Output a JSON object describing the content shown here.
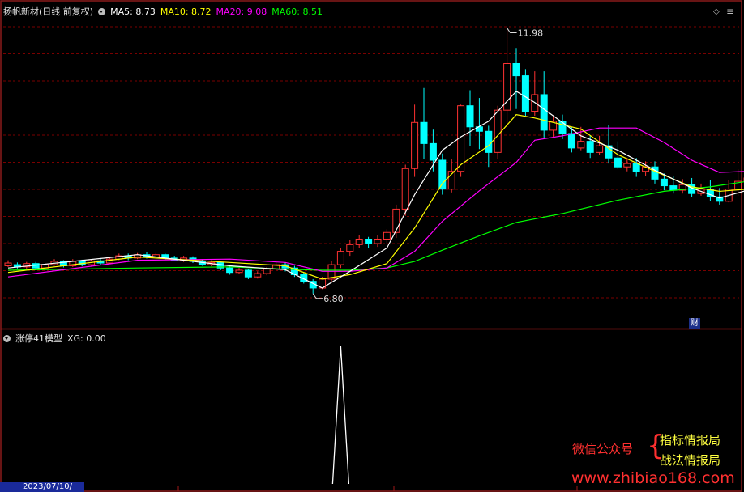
{
  "header": {
    "title": "扬帆新材(日线 前复权)",
    "ma": [
      {
        "label": "MA5:",
        "value": "8.73",
        "color": "#ffffff"
      },
      {
        "label": "MA10:",
        "value": "8.72",
        "color": "#ffff00"
      },
      {
        "label": "MA20:",
        "value": "9.08",
        "color": "#ff00ff"
      },
      {
        "label": "MA60:",
        "value": "8.51",
        "color": "#00ff00"
      }
    ]
  },
  "indicator": {
    "title": "涨停41模型",
    "label": "XG:",
    "value": "0.00"
  },
  "annotations": {
    "high": "11.98",
    "low": "6.80",
    "fin_badge": "财"
  },
  "axis": {
    "date_label": "2023/07/10/"
  },
  "watermark": {
    "left": "微信公众号",
    "right_top": "指标情报局",
    "right_bottom": "战法情报局",
    "url": "www.zhibiao168.com"
  },
  "colors": {
    "up": "#ff3232",
    "down": "#00ffff",
    "ma5": "#ffffff",
    "ma10": "#ffff00",
    "ma20": "#ff00ff",
    "ma60": "#00ff00",
    "grid": "#7a0000"
  },
  "chart_data": {
    "type": "candlestick",
    "yrange": [
      6.6,
      12.25
    ],
    "candles": [
      [
        7.7,
        7.75,
        7.68,
        7.8
      ],
      [
        7.72,
        7.68,
        7.65,
        7.76
      ],
      [
        7.68,
        7.74,
        7.65,
        7.77
      ],
      [
        7.74,
        7.66,
        7.62,
        7.77
      ],
      [
        7.66,
        7.72,
        7.63,
        7.75
      ],
      [
        7.72,
        7.78,
        7.7,
        7.82
      ],
      [
        7.78,
        7.7,
        7.67,
        7.8
      ],
      [
        7.7,
        7.78,
        7.68,
        7.82
      ],
      [
        7.78,
        7.72,
        7.69,
        7.81
      ],
      [
        7.72,
        7.79,
        7.7,
        7.82
      ],
      [
        7.79,
        7.75,
        7.72,
        7.83
      ],
      [
        7.75,
        7.82,
        7.73,
        7.85
      ],
      [
        7.82,
        7.88,
        7.8,
        7.92
      ],
      [
        7.88,
        7.84,
        7.8,
        7.92
      ],
      [
        7.84,
        7.9,
        7.82,
        7.93
      ],
      [
        7.9,
        7.86,
        7.83,
        7.94
      ],
      [
        7.86,
        7.9,
        7.83,
        7.93
      ],
      [
        7.9,
        7.84,
        7.81,
        7.92
      ],
      [
        7.84,
        7.8,
        7.78,
        7.88
      ],
      [
        7.8,
        7.84,
        7.77,
        7.88
      ],
      [
        7.84,
        7.78,
        7.75,
        7.87
      ],
      [
        7.78,
        7.72,
        7.7,
        7.82
      ],
      [
        7.72,
        7.76,
        7.69,
        7.8
      ],
      [
        7.76,
        7.66,
        7.62,
        7.78
      ],
      [
        7.66,
        7.58,
        7.54,
        7.7
      ],
      [
        7.58,
        7.62,
        7.55,
        7.66
      ],
      [
        7.62,
        7.5,
        7.46,
        7.64
      ],
      [
        7.5,
        7.56,
        7.47,
        7.6
      ],
      [
        7.56,
        7.64,
        7.53,
        7.68
      ],
      [
        7.64,
        7.72,
        7.62,
        7.76
      ],
      [
        7.72,
        7.66,
        7.6,
        7.76
      ],
      [
        7.66,
        7.54,
        7.5,
        7.7
      ],
      [
        7.54,
        7.42,
        7.38,
        7.58
      ],
      [
        7.42,
        7.3,
        7.2,
        7.46
      ],
      [
        7.3,
        7.46,
        7.28,
        7.5
      ],
      [
        7.46,
        7.72,
        7.42,
        7.78
      ],
      [
        7.72,
        7.96,
        7.66,
        8.02
      ],
      [
        7.96,
        8.08,
        7.88,
        8.16
      ],
      [
        8.08,
        8.18,
        8.02,
        8.26
      ],
      [
        8.18,
        8.1,
        8.02,
        8.22
      ],
      [
        8.1,
        8.18,
        8.04,
        8.26
      ],
      [
        8.18,
        8.3,
        8.1,
        8.36
      ],
      [
        8.3,
        8.72,
        8.2,
        8.8
      ],
      [
        8.72,
        9.45,
        8.6,
        9.52
      ],
      [
        9.45,
        10.28,
        9.3,
        10.6
      ],
      [
        10.28,
        9.9,
        9.62,
        10.9
      ],
      [
        9.9,
        9.6,
        9.4,
        10.15
      ],
      [
        9.6,
        9.08,
        8.98,
        9.72
      ],
      [
        9.08,
        9.4,
        9.02,
        9.62
      ],
      [
        9.4,
        10.58,
        9.3,
        10.6
      ],
      [
        10.58,
        10.2,
        9.86,
        10.86
      ],
      [
        10.2,
        10.12,
        9.8,
        10.72
      ],
      [
        10.12,
        9.74,
        9.48,
        10.22
      ],
      [
        9.74,
        10.5,
        9.62,
        10.58
      ],
      [
        10.5,
        11.34,
        10.2,
        11.98
      ],
      [
        11.34,
        11.12,
        10.52,
        11.62
      ],
      [
        11.12,
        10.48,
        10.4,
        11.24
      ],
      [
        10.48,
        10.78,
        10.4,
        11.2
      ],
      [
        10.78,
        10.14,
        9.98,
        11.2
      ],
      [
        10.14,
        10.3,
        10.02,
        10.4
      ],
      [
        10.3,
        10.08,
        9.98,
        10.42
      ],
      [
        10.08,
        9.82,
        9.74,
        10.2
      ],
      [
        9.82,
        9.94,
        9.78,
        10.2
      ],
      [
        9.94,
        9.74,
        9.64,
        10.04
      ],
      [
        9.74,
        9.86,
        9.7,
        10.04
      ],
      [
        9.86,
        9.64,
        9.54,
        10.24
      ],
      [
        9.64,
        9.48,
        9.44,
        9.94
      ],
      [
        9.48,
        9.54,
        9.4,
        9.64
      ],
      [
        9.54,
        9.4,
        9.3,
        9.64
      ],
      [
        9.4,
        9.48,
        9.32,
        9.58
      ],
      [
        9.48,
        9.26,
        9.18,
        9.58
      ],
      [
        9.26,
        9.14,
        9.06,
        9.36
      ],
      [
        9.14,
        9.06,
        9.0,
        9.32
      ],
      [
        9.06,
        9.16,
        9.0,
        9.26
      ],
      [
        9.16,
        9.0,
        8.94,
        9.28
      ],
      [
        9.0,
        9.08,
        8.96,
        9.18
      ],
      [
        9.08,
        8.94,
        8.86,
        9.24
      ],
      [
        8.94,
        8.86,
        8.8,
        9.1
      ],
      [
        8.86,
        9.08,
        8.84,
        9.24
      ],
      [
        9.08,
        9.22,
        8.96,
        9.44
      ],
      [
        9.22,
        9.28,
        9.18,
        9.5
      ]
    ],
    "ma5": [
      [
        0,
        7.66
      ],
      [
        14,
        7.9
      ],
      [
        24,
        7.7
      ],
      [
        30,
        7.63
      ],
      [
        34,
        7.3
      ],
      [
        37,
        7.6
      ],
      [
        41,
        8.02
      ],
      [
        44,
        8.98
      ],
      [
        47,
        9.78
      ],
      [
        49,
        10.02
      ],
      [
        52,
        10.3
      ],
      [
        55,
        10.84
      ],
      [
        57,
        10.64
      ],
      [
        62,
        10.04
      ],
      [
        66,
        9.78
      ],
      [
        70,
        9.42
      ],
      [
        74,
        9.1
      ],
      [
        77,
        8.92
      ],
      [
        80,
        9.06
      ]
    ],
    "ma10": [
      [
        0,
        7.58
      ],
      [
        14,
        7.86
      ],
      [
        24,
        7.76
      ],
      [
        30,
        7.7
      ],
      [
        34,
        7.46
      ],
      [
        37,
        7.54
      ],
      [
        41,
        7.74
      ],
      [
        44,
        8.38
      ],
      [
        47,
        9.18
      ],
      [
        49,
        9.52
      ],
      [
        52,
        9.86
      ],
      [
        55,
        10.42
      ],
      [
        57,
        10.36
      ],
      [
        62,
        10.16
      ],
      [
        66,
        9.7
      ],
      [
        70,
        9.4
      ],
      [
        74,
        9.12
      ],
      [
        77,
        9.04
      ],
      [
        80,
        9.08
      ]
    ],
    "ma20": [
      [
        0,
        7.5
      ],
      [
        14,
        7.8
      ],
      [
        24,
        7.82
      ],
      [
        30,
        7.76
      ],
      [
        34,
        7.6
      ],
      [
        37,
        7.6
      ],
      [
        41,
        7.66
      ],
      [
        44,
        7.96
      ],
      [
        47,
        8.5
      ],
      [
        51,
        9.05
      ],
      [
        55,
        9.56
      ],
      [
        57,
        9.96
      ],
      [
        60,
        10.04
      ],
      [
        64,
        10.18
      ],
      [
        68,
        10.18
      ],
      [
        71,
        9.92
      ],
      [
        74,
        9.6
      ],
      [
        77,
        9.38
      ],
      [
        80,
        9.4
      ]
    ],
    "ma60": [
      [
        0,
        7.62
      ],
      [
        14,
        7.66
      ],
      [
        24,
        7.68
      ],
      [
        30,
        7.64
      ],
      [
        34,
        7.62
      ],
      [
        37,
        7.62
      ],
      [
        41,
        7.66
      ],
      [
        44,
        7.78
      ],
      [
        47,
        7.98
      ],
      [
        51,
        8.24
      ],
      [
        55,
        8.48
      ],
      [
        60,
        8.64
      ],
      [
        66,
        8.88
      ],
      [
        71,
        9.04
      ],
      [
        76,
        9.12
      ],
      [
        80,
        9.22
      ]
    ],
    "xg": {
      "spike_index": 36,
      "value": 1
    }
  }
}
